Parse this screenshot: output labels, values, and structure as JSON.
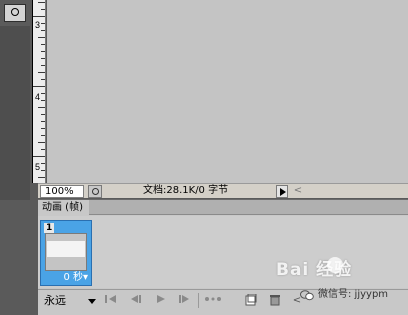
{
  "ruler": {
    "marks": [
      "3",
      "4",
      "5"
    ]
  },
  "status": {
    "zoom": "100%",
    "doc_info": "文档:28.1K/0 字节",
    "scroll_left": "<"
  },
  "animation_panel": {
    "tab_label": "动画 (帧)",
    "frame": {
      "number": "1",
      "delay": "0 秒▾"
    },
    "loop_option": "永远"
  },
  "watermark": {
    "logo_text": "Bai  经验",
    "account": "微信号: jjyypm"
  }
}
